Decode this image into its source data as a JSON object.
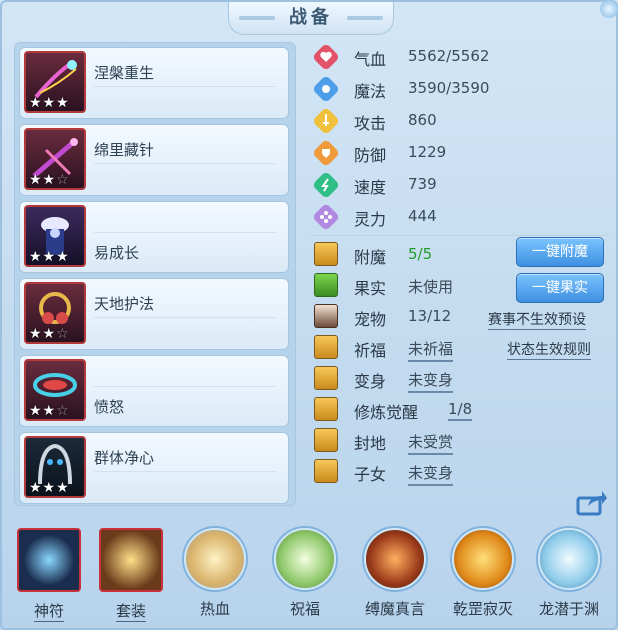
{
  "title": "战备",
  "equipment": [
    {
      "name": "涅槃重生",
      "stars_filled": 3,
      "stars_total": 3,
      "icon": "phoenix-rebirth-icon"
    },
    {
      "name": "绵里藏针",
      "stars_filled": 2,
      "stars_total": 3,
      "icon": "hidden-needle-icon"
    },
    {
      "name": "易成长",
      "stars_filled": 3,
      "stars_total": 3,
      "icon": "easy-growth-icon"
    },
    {
      "name": "天地护法",
      "stars_filled": 2,
      "stars_total": 3,
      "icon": "heaven-earth-guard-icon"
    },
    {
      "name": "愤怒",
      "stars_filled": 2,
      "stars_total": 3,
      "icon": "anger-icon"
    },
    {
      "name": "群体净心",
      "stars_filled": 3,
      "stars_total": 3,
      "icon": "group-purify-icon"
    }
  ],
  "stats": [
    {
      "label": "气血",
      "value": "5562/5562",
      "icon": "heart-icon",
      "color": "#e2536a"
    },
    {
      "label": "魔法",
      "value": "3590/3590",
      "icon": "magic-icon",
      "color": "#4c9ee8"
    },
    {
      "label": "攻击",
      "value": "860",
      "icon": "sword-icon",
      "color": "#f0c13c"
    },
    {
      "label": "防御",
      "value": "1229",
      "icon": "shield-icon",
      "color": "#f09a3c"
    },
    {
      "label": "速度",
      "value": "739",
      "icon": "speed-icon",
      "color": "#2fbf86"
    },
    {
      "label": "灵力",
      "value": "444",
      "icon": "spirit-icon",
      "color": "#b08ae0"
    }
  ],
  "extras": [
    {
      "label": "附魔",
      "value": "5/5",
      "icon": "enchant-icon"
    },
    {
      "label": "果实",
      "value": "未使用",
      "icon": "fruit-icon"
    },
    {
      "label": "宠物",
      "value": "13/12",
      "icon": "pet-icon"
    },
    {
      "label": "祈福",
      "value": "未祈福",
      "icon": "blessing-icon"
    },
    {
      "label": "变身",
      "value": "未变身",
      "icon": "transform-icon"
    },
    {
      "label": "修炼觉醒",
      "value": "1/8",
      "icon": "cultivation-icon"
    },
    {
      "label": "封地",
      "value": "未受赏",
      "icon": "fief-icon"
    },
    {
      "label": "子女",
      "value": "未变身",
      "icon": "children-icon"
    }
  ],
  "buttons": {
    "enchant": "一键附魔",
    "fruit": "一键果实"
  },
  "links": {
    "event_preset": "赛事不生效预设",
    "status_rules": "状态生效规则"
  },
  "bottom_tabs": [
    {
      "label": "神符",
      "icon": "rune-icon"
    },
    {
      "label": "套装",
      "icon": "suit-icon"
    },
    {
      "label": "热血",
      "icon": "hot-blood-icon"
    },
    {
      "label": "祝福",
      "icon": "bless-icon"
    },
    {
      "label": "缚魔真言",
      "icon": "bind-demon-icon"
    },
    {
      "label": "乾罡寂灭",
      "icon": "qiangang-icon"
    },
    {
      "label": "龙潜于渊",
      "icon": "dragon-icon"
    }
  ],
  "colors": {
    "accent_button": "#3d8fe0",
    "highlight_green": "#1f9c2a",
    "frame_red": "#c8323a"
  }
}
